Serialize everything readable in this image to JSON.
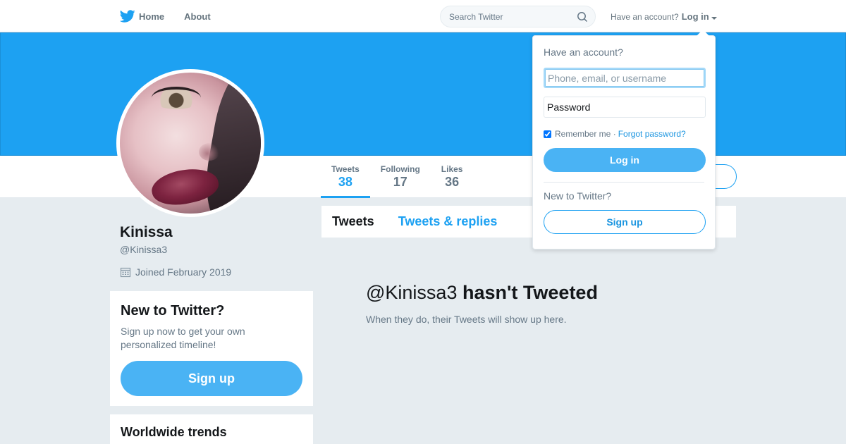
{
  "nav": {
    "home_label": "Home",
    "about_label": "About",
    "search_placeholder": "Search Twitter",
    "have_account": "Have an account?",
    "login_label": "Log in"
  },
  "profile": {
    "name": "Kinissa",
    "handle": "@Kinissa3",
    "joined": "Joined February 2019",
    "stats": [
      {
        "label": "Tweets",
        "value": "38"
      },
      {
        "label": "Following",
        "value": "17"
      },
      {
        "label": "Likes",
        "value": "36"
      }
    ]
  },
  "timeline": {
    "tabs": [
      {
        "label": "Tweets"
      },
      {
        "label": "Tweets & replies"
      }
    ],
    "empty_handle": "@Kinissa3",
    "empty_title": "hasn't Tweeted",
    "empty_sub": "When they do, their Tweets will show up here."
  },
  "signup_card": {
    "title": "New to Twitter?",
    "text": "Sign up now to get your own personalized timeline!",
    "button": "Sign up"
  },
  "trends_card": {
    "title": "Worldwide trends"
  },
  "login_dropdown": {
    "heading": "Have an account?",
    "username_placeholder": "Phone, email, or username",
    "password_placeholder": "Password",
    "remember_me": "Remember me ·",
    "forgot_password": "Forgot password?",
    "remember_checked": true,
    "login_button": "Log in",
    "new_to_twitter": "New to Twitter?",
    "signup_button": "Sign up"
  },
  "colors": {
    "brand_blue": "#1da1f2",
    "button_blue": "#4ab3f4",
    "background": "#e6ecf0"
  },
  "icons": [
    "twitter-bird-icon",
    "search-icon",
    "caret-down-icon",
    "calendar-icon"
  ]
}
